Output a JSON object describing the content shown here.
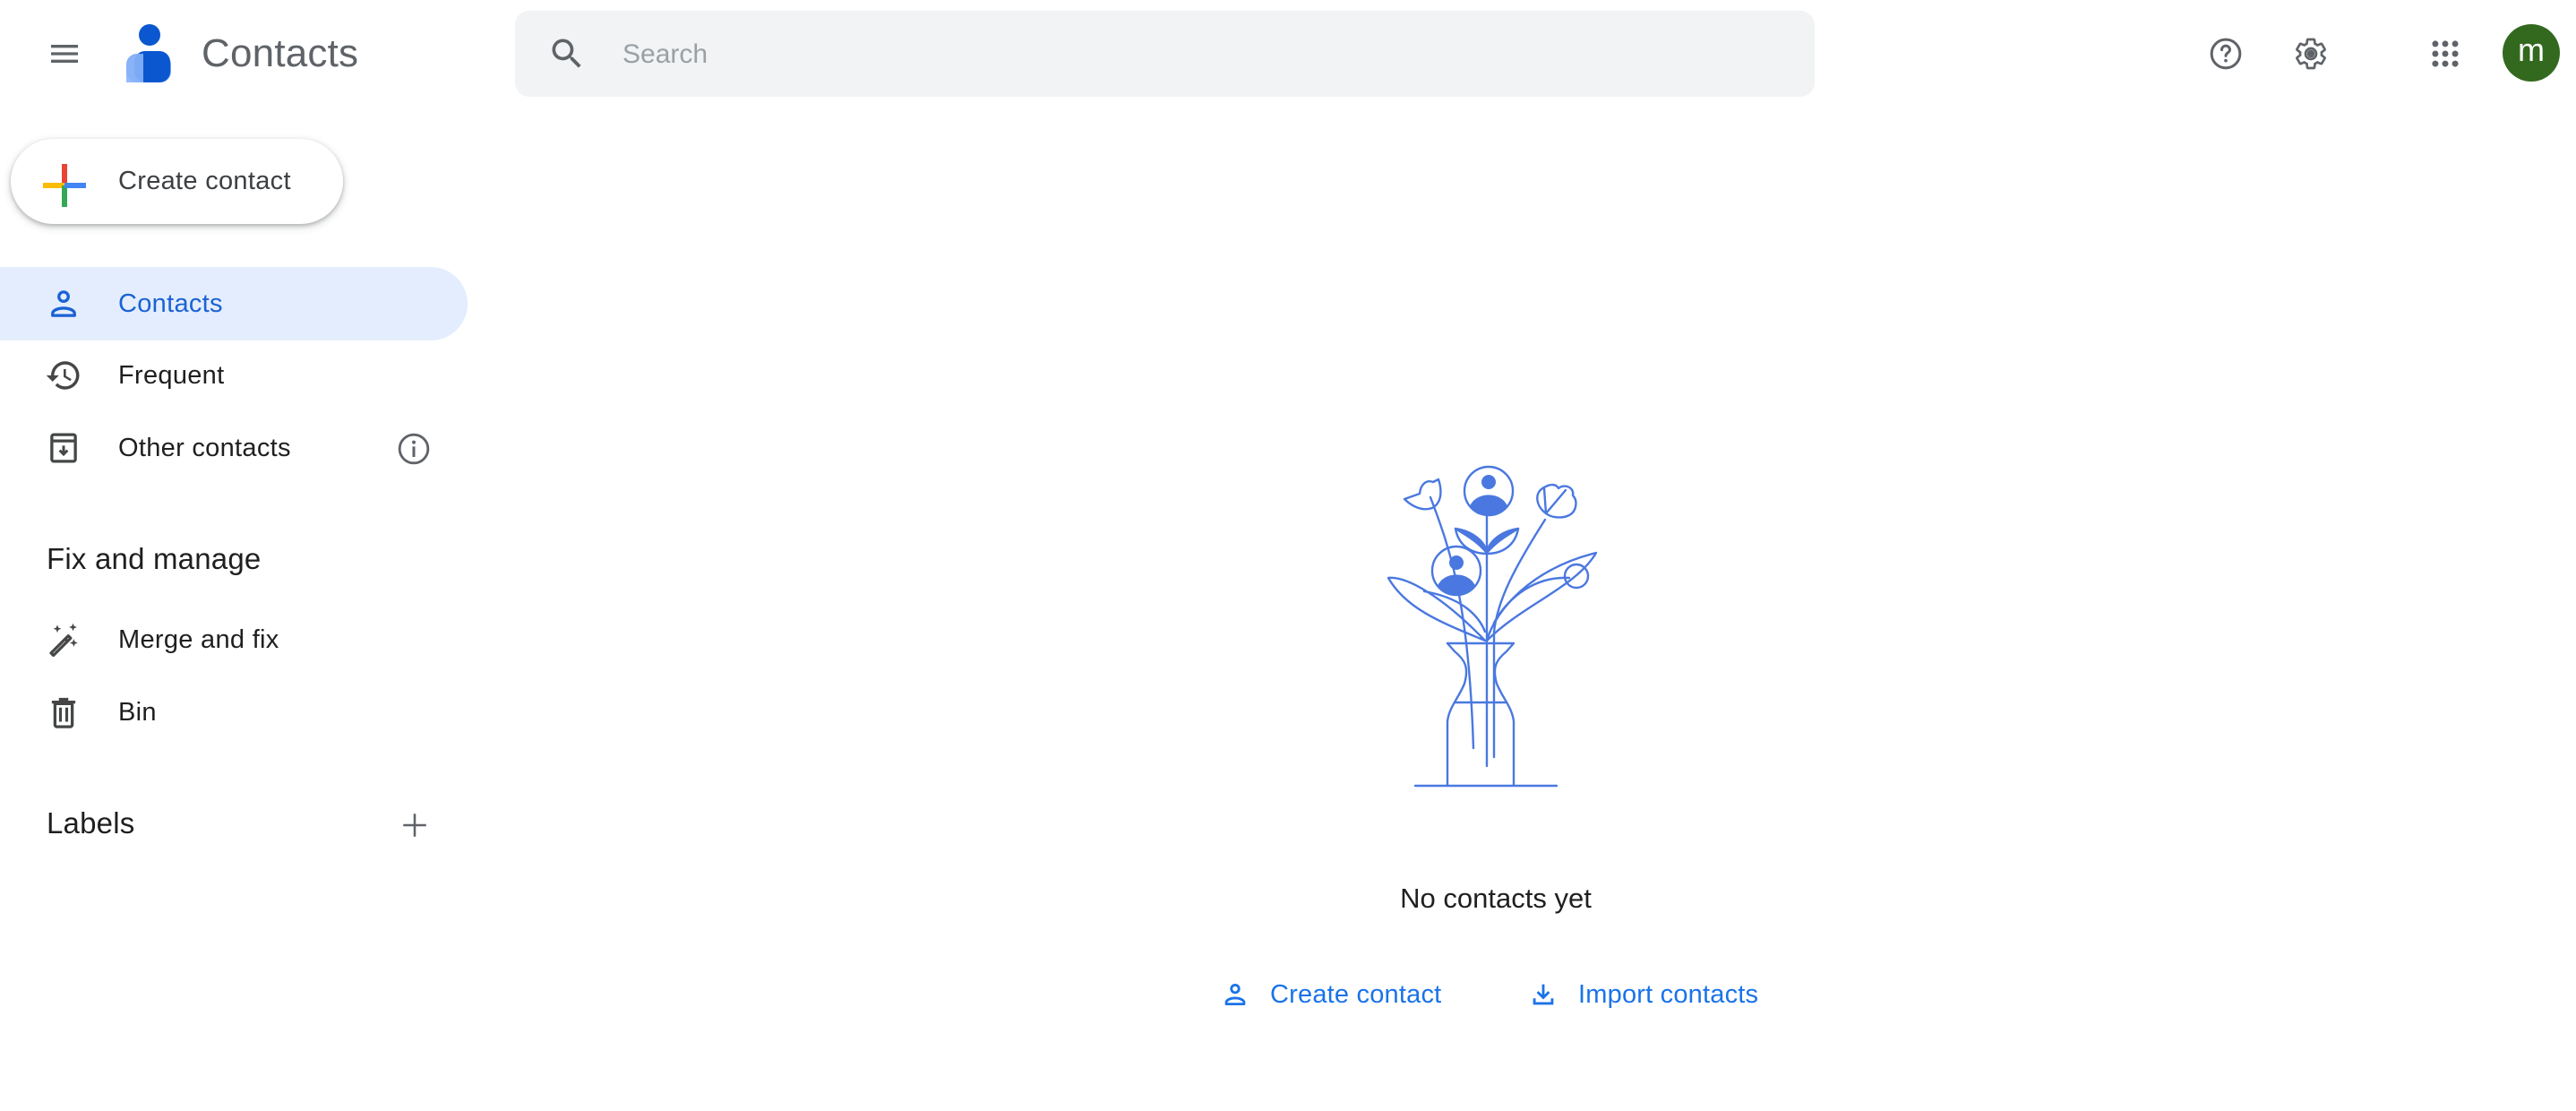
{
  "header": {
    "menu_icon": "hamburger-menu-icon",
    "app_title": "Contacts",
    "search": {
      "placeholder": "Search",
      "value": ""
    },
    "help_icon": "help-circle-icon",
    "settings_icon": "gear-icon",
    "apps_icon": "apps-grid-icon",
    "avatar": {
      "initial": "m",
      "color": "#33691e"
    }
  },
  "sidebar": {
    "create_button": {
      "label": "Create contact"
    },
    "nav": [
      {
        "label": "Contacts",
        "icon": "person-icon",
        "active": true
      },
      {
        "label": "Frequent",
        "icon": "history-icon",
        "active": false
      },
      {
        "label": "Other contacts",
        "icon": "archive-download-icon",
        "active": false,
        "info_icon": "info-icon"
      }
    ],
    "fix_section": {
      "heading": "Fix and manage",
      "items": [
        {
          "label": "Merge and fix",
          "icon": "magic-wand-icon"
        },
        {
          "label": "Bin",
          "icon": "trash-icon"
        }
      ]
    },
    "labels_section": {
      "heading": "Labels",
      "add_icon": "plus-icon"
    }
  },
  "main": {
    "empty_state": {
      "illustration": "vase-with-flowers-contacts-illustration",
      "message": "No contacts yet",
      "actions": [
        {
          "label": "Create contact",
          "icon": "person-icon"
        },
        {
          "label": "Import contacts",
          "icon": "download-icon"
        }
      ]
    }
  },
  "colors": {
    "accent": "#1a73e8",
    "active_nav_bg": "#e3edfd",
    "search_bg": "#f1f3f4",
    "illustration": "#4a78e0",
    "icon_gray": "#5f6368"
  }
}
